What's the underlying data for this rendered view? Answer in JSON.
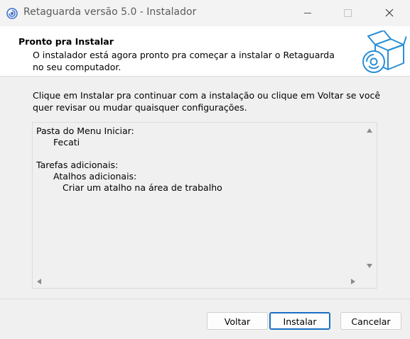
{
  "window": {
    "title": "Retaguarda versão 5.0 - Instalador",
    "icon": "app-swirl-icon",
    "controls": [
      "minimize-icon",
      "maximize-icon",
      "close-icon"
    ]
  },
  "header": {
    "title": "Pronto pra Instalar",
    "description": "O instalador está agora pronto pra começar a instalar o Retaguarda no seu computador.",
    "image": "installer-box-disc-icon"
  },
  "body": {
    "intro": "Clique em Instalar pra continuar com a instalação ou clique em Voltar se você quer revisar ou mudar quaisquer configurações.",
    "summary": {
      "start_menu_label": "Pasta do Menu Iniciar:",
      "start_menu_value": "Fecati",
      "tasks_label": "Tarefas adicionais:",
      "shortcuts_label": "Atalhos adicionais:",
      "shortcut_item": "Criar um atalho na área de trabalho"
    }
  },
  "buttons": {
    "back": "Voltar",
    "install": "Instalar",
    "cancel": "Cancelar"
  },
  "colors": {
    "accent": "#1a6fc4",
    "icon_blue": "#2a8fd6"
  }
}
